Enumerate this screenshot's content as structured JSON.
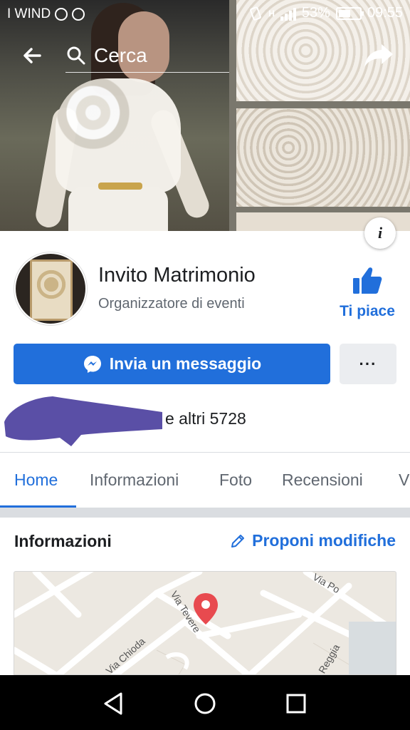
{
  "status_bar": {
    "carrier": "I WIND",
    "battery": "53%",
    "time": "09:55",
    "network": "H"
  },
  "header": {
    "search_placeholder": "Cerca",
    "back_icon": "back-arrow-icon",
    "share_icon": "share-icon"
  },
  "page": {
    "name": "Invito Matrimonio",
    "category": "Organizzatore di eventi",
    "like_label": "Ti piace",
    "info_badge": "i"
  },
  "actions": {
    "message_label": "Invia un messaggio",
    "more_label": "···"
  },
  "likes": {
    "text": "e altri 5728"
  },
  "tabs": [
    {
      "label": "Home",
      "active": true
    },
    {
      "label": "Informazioni",
      "active": false
    },
    {
      "label": "Foto",
      "active": false
    },
    {
      "label": "Recensioni",
      "active": false
    },
    {
      "label": "V",
      "active": false
    }
  ],
  "info_section": {
    "title": "Informazioni",
    "propose_label": "Proponi modifiche"
  },
  "map": {
    "streets": [
      "Via Tevere",
      "Via Po",
      "Via Chioda",
      "Reggia"
    ]
  },
  "colors": {
    "accent": "#216fdb",
    "secondary_text": "#606770",
    "button_gray": "#ebedf0",
    "map_pin": "#e84a4f"
  }
}
